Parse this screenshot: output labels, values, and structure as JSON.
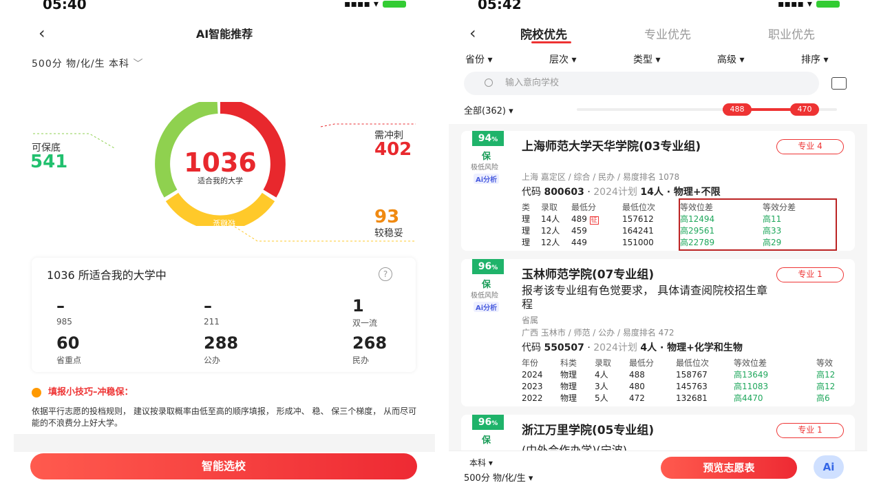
{
  "left": {
    "status_time": "05:40",
    "title": "AI智能推荐",
    "sub_info": "500分 物/化/生  本科",
    "donut": {
      "total": "1036",
      "total_label": "适合我的大学",
      "seg_bao": "可保底",
      "seg_chong": "需冲刺",
      "seg_wen": "较稳妥",
      "bao_value": 541,
      "chong_value": 402,
      "wen_value": 93
    },
    "side": {
      "bao_label": "可保底",
      "bao_num": "541",
      "chong_label": "需冲刺",
      "chong_num": "402",
      "wen_num": "93",
      "wen_label": "较稳妥"
    },
    "stats": {
      "head": "1036 所适合我的大学中",
      "items": [
        {
          "v": "–",
          "l": "985"
        },
        {
          "v": "–",
          "l": "211"
        },
        {
          "v": "1",
          "l": "双一流"
        },
        {
          "v": "60",
          "l": "省重点"
        },
        {
          "v": "288",
          "l": "公办"
        },
        {
          "v": "268",
          "l": "民办"
        }
      ]
    },
    "tip": {
      "title": "填报小技巧–冲稳保：",
      "body": "依据平行志愿的投档规则， 建议按录取概率由低至高的顺序填报， 形成冲、 稳、 保三个梯度， 从而尽可能的不浪费分上好大学。"
    },
    "button": "智能选校",
    "colors": {
      "green": "#8fd14f",
      "red": "#e8282d",
      "yellow": "#ffc92a"
    }
  },
  "right": {
    "status_time": "05:42",
    "tabs": [
      "院校优先",
      "专业优先",
      "职业优先"
    ],
    "filters": [
      "省份",
      "层次",
      "类型",
      "高级",
      "排序"
    ],
    "search_placeholder": "输入意向学校",
    "all_count": "全部(362)",
    "range": {
      "low": "488",
      "high": "470"
    },
    "cards": [
      {
        "pct": "94",
        "pct_unit": "%",
        "bao": "保",
        "risk": "极低风险",
        "ai": "Ai分析",
        "name": "上海师范大学天华学院(03专业组)",
        "major": "专业 4",
        "meta": "上海 嘉定区 / 综合 / 民办 / 易度排名 1078",
        "code": "800603",
        "plan": "2024计划",
        "plan_num": "14人 · 物理+不限",
        "headers": [
          "类",
          "录取",
          "最低分",
          "最低位次",
          "等效位差",
          "等效分差"
        ],
        "rows": [
          [
            "理",
            "14人",
            "489",
            "157612",
            "高12494",
            "高11"
          ],
          [
            "理",
            "12人",
            "459",
            "164241",
            "高29561",
            "高33"
          ],
          [
            "理",
            "12人",
            "449",
            "151000",
            "高22789",
            "高29"
          ]
        ],
        "zheng": "征"
      },
      {
        "pct": "96",
        "pct_unit": "%",
        "bao": "保",
        "risk": "极低风险",
        "ai": "Ai分析",
        "name": "玉林师范学院(07专业组)",
        "major": "专业 1",
        "note": "报考该专业组有色觉要求， 具体请查阅院校招生章程",
        "note2": "省属",
        "meta": "广西 玉林市 / 师范 / 公办 / 易度排名 472",
        "code": "550507",
        "plan": "2024计划",
        "plan_num": "4人 · 物理+化学和生物",
        "headers": [
          "年份",
          "科类",
          "录取",
          "最低分",
          "最低位次",
          "等效位差",
          "等效"
        ],
        "rows": [
          [
            "2024",
            "物理",
            "4人",
            "488",
            "158767",
            "高13649",
            "高12"
          ],
          [
            "2023",
            "物理",
            "3人",
            "480",
            "145763",
            "高11083",
            "高12"
          ],
          [
            "2022",
            "物理",
            "5人",
            "472",
            "132681",
            "高4470",
            "高6"
          ]
        ]
      },
      {
        "pct": "96",
        "pct_unit": "%",
        "bao": "保",
        "name": "浙江万里学院(05专业组)",
        "sub": "(中外合作办学)(宁波)",
        "major": "专业 1"
      }
    ],
    "bottom": {
      "level": "本科",
      "score": "500分 物/化/生",
      "preview": "预览志愿表",
      "ai": "Ai"
    }
  }
}
